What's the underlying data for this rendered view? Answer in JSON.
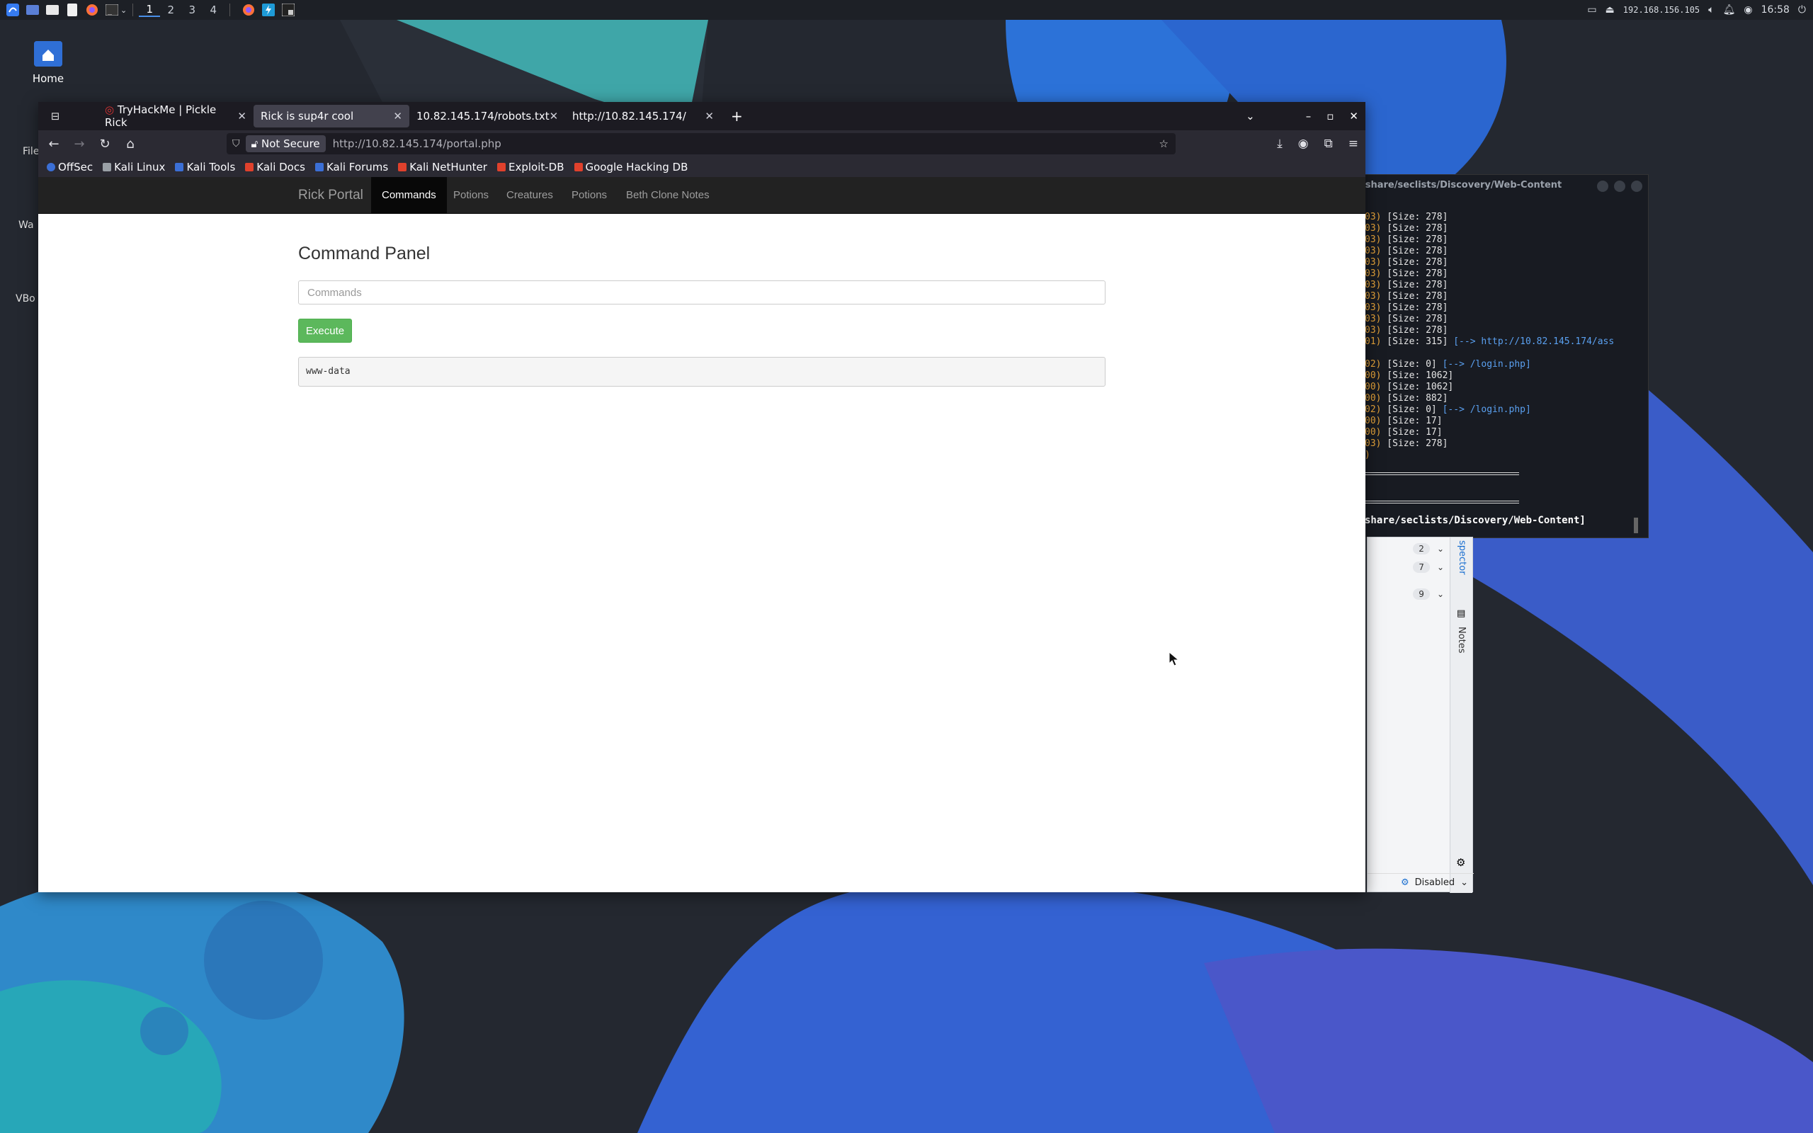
{
  "panel": {
    "workspaces": [
      "1",
      "2",
      "3",
      "4"
    ],
    "active_workspace": "1",
    "ip": "192.168.156.105",
    "clock": "16:58"
  },
  "desktop": {
    "home_label": "Home",
    "partial_labels": [
      "File",
      "Wa",
      "VBo"
    ]
  },
  "browser": {
    "tabs": [
      {
        "label": "TryHackMe | Pickle Rick",
        "active": false
      },
      {
        "label": "Rick is sup4r cool",
        "active": true
      },
      {
        "label": "10.82.145.174/robots.txt",
        "active": false
      },
      {
        "label": "http://10.82.145.174/",
        "active": false
      }
    ],
    "security_label": "Not Secure",
    "url": "http://10.82.145.174/portal.php",
    "bookmarks": [
      {
        "label": "OffSec",
        "color": "#3b6fd6"
      },
      {
        "label": "Kali Linux",
        "color": "#9aa0a6"
      },
      {
        "label": "Kali Tools",
        "color": "#3b6fd6"
      },
      {
        "label": "Kali Docs",
        "color": "#e0412c"
      },
      {
        "label": "Kali Forums",
        "color": "#3b6fd6"
      },
      {
        "label": "Kali NetHunter",
        "color": "#e0412c"
      },
      {
        "label": "Exploit-DB",
        "color": "#e0412c"
      },
      {
        "label": "Google Hacking DB",
        "color": "#e0412c"
      }
    ]
  },
  "site": {
    "brand": "Rick Portal",
    "nav": [
      "Commands",
      "Potions",
      "Creatures",
      "Potions",
      "Beth Clone Notes"
    ],
    "active_nav": "Commands",
    "panel_title": "Command Panel",
    "input_placeholder": "Commands",
    "execute_label": "Execute",
    "output": "www-data"
  },
  "terminal": {
    "title": "/share/seclists/Discovery/Web-Content",
    "lines": [
      {
        "code": "03)",
        "text": " [Size: 278]",
        "redirect": ""
      },
      {
        "code": "03)",
        "text": " [Size: 278]",
        "redirect": ""
      },
      {
        "code": "03)",
        "text": " [Size: 278]",
        "redirect": ""
      },
      {
        "code": "03)",
        "text": " [Size: 278]",
        "redirect": ""
      },
      {
        "code": "03)",
        "text": " [Size: 278]",
        "redirect": ""
      },
      {
        "code": "03)",
        "text": " [Size: 278]",
        "redirect": ""
      },
      {
        "code": "03)",
        "text": " [Size: 278]",
        "redirect": ""
      },
      {
        "code": "03)",
        "text": " [Size: 278]",
        "redirect": ""
      },
      {
        "code": "03)",
        "text": " [Size: 278]",
        "redirect": ""
      },
      {
        "code": "03)",
        "text": " [Size: 278]",
        "redirect": ""
      },
      {
        "code": "03)",
        "text": " [Size: 278]",
        "redirect": ""
      },
      {
        "code": "01)",
        "text": " [Size: 315]",
        "redirect": " [--> http://10.82.145.174/ass"
      },
      {
        "code": "",
        "text": "",
        "redirect": ""
      },
      {
        "code": "02)",
        "text": " [Size: 0]",
        "redirect": " [--> /login.php]"
      },
      {
        "code": "00)",
        "text": " [Size: 1062]",
        "redirect": ""
      },
      {
        "code": "00)",
        "text": " [Size: 1062]",
        "redirect": ""
      },
      {
        "code": "00)",
        "text": " [Size: 882]",
        "redirect": ""
      },
      {
        "code": "02)",
        "text": " [Size: 0]",
        "redirect": " [--> /login.php]"
      },
      {
        "code": "00)",
        "text": " [Size: 17]",
        "redirect": ""
      },
      {
        "code": "00)",
        "text": " [Size: 17]",
        "redirect": ""
      },
      {
        "code": "03)",
        "text": " [Size: 278]",
        "redirect": ""
      },
      {
        "code": ")",
        "text": "",
        "redirect": ""
      }
    ],
    "prompt": "share/seclists/Discovery/Web-Content]"
  },
  "sidepanel": {
    "rows": [
      "2",
      "7",
      "9"
    ],
    "vtab_top": "spector",
    "vtab_notes": "Notes",
    "footer_label": "Disabled"
  }
}
